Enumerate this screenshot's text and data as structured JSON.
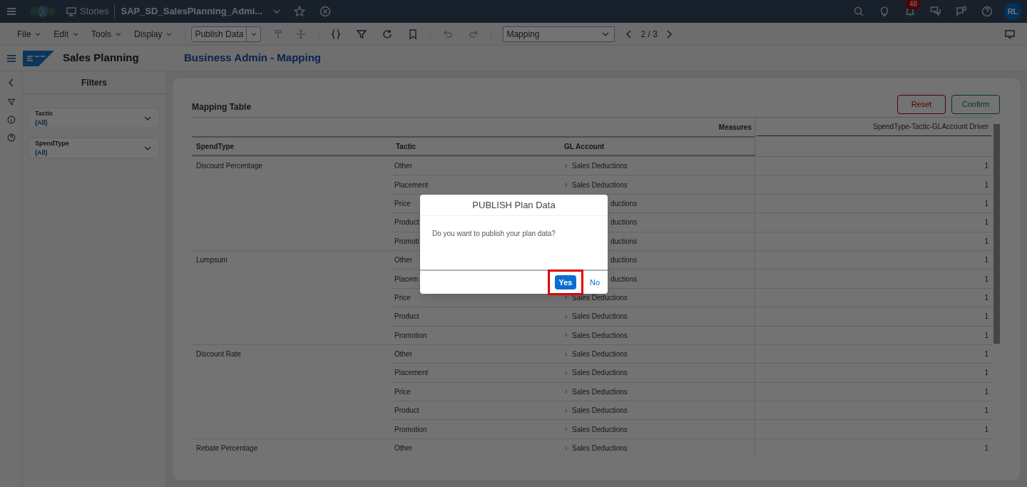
{
  "shell": {
    "section": "Stories",
    "story_title": "SAP_SD_SalesPlanning_Admi...",
    "notification_count": "48",
    "avatar": "RL"
  },
  "toolbar": {
    "menus": [
      "File",
      "Edit",
      "Tools",
      "Display"
    ],
    "publish_button": "Publish Data",
    "page_select": "Mapping",
    "pager": "2 / 3"
  },
  "header": {
    "app_title": "Sales Planning",
    "page_title": "Business Admin - Mapping"
  },
  "filters": {
    "title": "Filters",
    "items": [
      {
        "label": "Tactic",
        "value": "(All)"
      },
      {
        "label": "SpendType",
        "value": "(All)"
      }
    ]
  },
  "table": {
    "title": "Mapping Table",
    "buttons": [
      {
        "label": "Reset",
        "kind": "reset"
      },
      {
        "label": "Confirm",
        "kind": "confirm"
      }
    ],
    "measures_label": "Measures",
    "measure_column": "SpendType-Tactic-GLAccount Driver",
    "columns": [
      "SpendType",
      "Tactic",
      "GL Account"
    ],
    "rows": [
      {
        "spend_type": "Discount Percentage",
        "tactic": "Other",
        "gl_account": "Sales Deductions",
        "value": "1"
      },
      {
        "tactic": "Placement",
        "gl_account": "Sales Deductions",
        "value": "1"
      },
      {
        "tactic": "Price",
        "gl_account": "ductions",
        "value": "1",
        "kind": "covered"
      },
      {
        "tactic": "Product",
        "gl_account": "ductions",
        "value": "1",
        "kind": "covered"
      },
      {
        "tactic": "Promoti",
        "gl_account": "ductions",
        "value": "1",
        "kind": "covered"
      },
      {
        "spend_type": "Lumpsum",
        "tactic": "Other",
        "gl_account": "ductions",
        "value": "1",
        "kind": "covered"
      },
      {
        "tactic": "Placem",
        "gl_account": "ductions",
        "value": "1",
        "kind": "covered"
      },
      {
        "tactic": "Price",
        "gl_account": "Sales Deductions",
        "value": "1"
      },
      {
        "tactic": "Product",
        "gl_account": "Sales Deductions",
        "value": "1"
      },
      {
        "tactic": "Promotion",
        "gl_account": "Sales Deductions",
        "value": "1"
      },
      {
        "spend_type": "Discount Rate",
        "tactic": "Other",
        "gl_account": "Sales Deductions",
        "value": "1"
      },
      {
        "tactic": "Placement",
        "gl_account": "Sales Deductions",
        "value": "1"
      },
      {
        "tactic": "Price",
        "gl_account": "Sales Deductions",
        "value": "1"
      },
      {
        "tactic": "Product",
        "gl_account": "Sales Deductions",
        "value": "1"
      },
      {
        "tactic": "Promotion",
        "gl_account": "Sales Deductions",
        "value": "1"
      },
      {
        "spend_type": "Rebate Percentage",
        "tactic": "Other",
        "gl_account": "Sales Deductions",
        "value": "1"
      }
    ]
  },
  "dialog": {
    "title": "PUBLISH Plan Data",
    "message": "Do you want to publish your plan data?",
    "buttons": [
      {
        "label": "Yes",
        "kind": "primary",
        "highlighted": true
      },
      {
        "label": "No",
        "kind": "link",
        "highlighted": false
      }
    ]
  }
}
